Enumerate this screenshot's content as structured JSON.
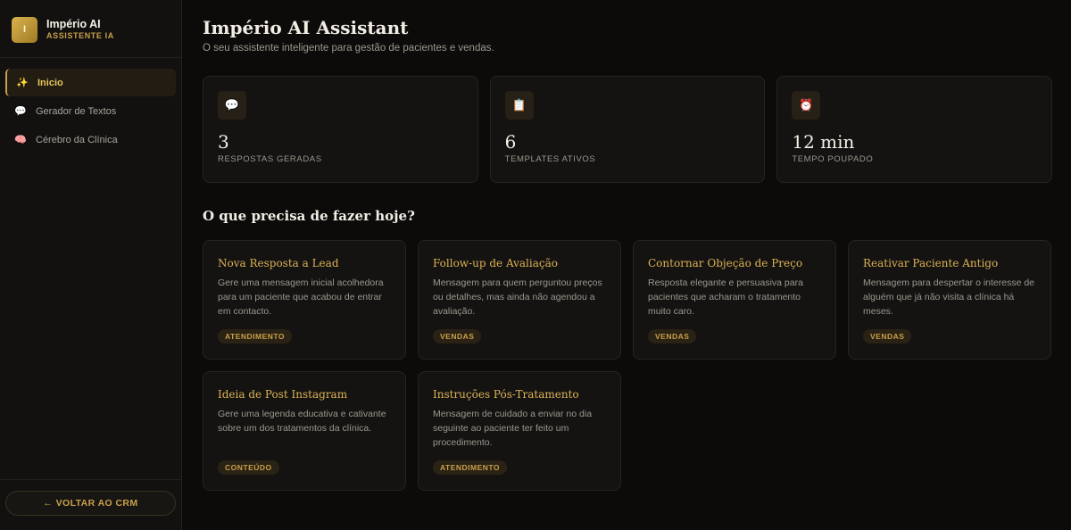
{
  "brand": {
    "initial": "I",
    "name": "Império AI",
    "subtitle": "ASSISTENTE IA"
  },
  "nav": [
    {
      "label": "Inicio",
      "icon": "✨",
      "active": true
    },
    {
      "label": "Gerador de Textos",
      "icon": "💬",
      "active": false
    },
    {
      "label": "Cérebro da Clínica",
      "icon": "🧠",
      "active": false
    }
  ],
  "back_button": "← VOLTAR AO CRM",
  "header": {
    "title": "Império AI Assistant",
    "subtitle": "O seu assistente inteligente para gestão de pacientes e vendas."
  },
  "stats": [
    {
      "icon": "💬",
      "value": "3",
      "label": "RESPOSTAS GERADAS"
    },
    {
      "icon": "📋",
      "value": "6",
      "label": "TEMPLATES ATIVOS"
    },
    {
      "icon": "⏰",
      "value": "12 min",
      "label": "TEMPO POUPADO"
    }
  ],
  "section_title": "O que precisa de fazer hoje?",
  "cards": [
    {
      "title": "Nova Resposta a Lead",
      "desc": "Gere uma mensagem inicial acolhedora para um paciente que acabou de entrar em contacto.",
      "tag": "ATENDIMENTO"
    },
    {
      "title": "Follow-up de Avaliação",
      "desc": "Mensagem para quem perguntou preços ou detalhes, mas ainda não agendou a avaliação.",
      "tag": "VENDAS"
    },
    {
      "title": "Contornar Objeção de Preço",
      "desc": "Resposta elegante e persuasiva para pacientes que acharam o tratamento muito caro.",
      "tag": "VENDAS"
    },
    {
      "title": "Reativar Paciente Antigo",
      "desc": "Mensagem para despertar o interesse de alguém que já não visita a clínica há meses.",
      "tag": "VENDAS"
    },
    {
      "title": "Ideia de Post Instagram",
      "desc": "Gere uma legenda educativa e cativante sobre um dos tratamentos da clínica.",
      "tag": "CONTEÚDO"
    },
    {
      "title": "Instruções Pós-Tratamento",
      "desc": "Mensagem de cuidado a enviar no dia seguinte ao paciente ter feito um procedimento.",
      "tag": "ATENDIMENTO"
    }
  ],
  "colors": {
    "accent": "#c9a04a",
    "background": "#0c0b0a",
    "card": "#141312"
  }
}
